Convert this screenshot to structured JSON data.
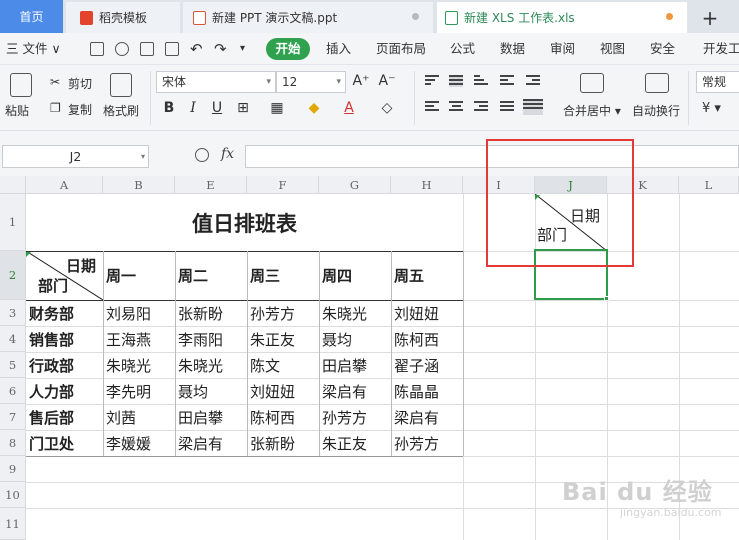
{
  "tabs": [
    {
      "label": "首页"
    },
    {
      "label": "稻壳模板"
    },
    {
      "label": "新建 PPT 演示文稿.ppt"
    },
    {
      "label": "新建 XLS 工作表.xls"
    }
  ],
  "new_tab_label": "+",
  "menu": {
    "file": "三 文件 ∨",
    "items": [
      "开始",
      "插入",
      "页面布局",
      "公式",
      "数据",
      "审阅",
      "视图",
      "安全",
      "开发工"
    ]
  },
  "ribbon": {
    "paste": "粘贴",
    "cut": "剪切",
    "copy": "复制",
    "format_painter": "格式刷",
    "font_name": "宋体",
    "font_size": "12",
    "merge_center": "合并居中",
    "wrap_text": "自动换行",
    "number_format": "常规"
  },
  "formula_bar": {
    "cell_ref": "J2",
    "fx": "fx",
    "formula": ""
  },
  "columns": [
    "A",
    "B",
    "E",
    "F",
    "G",
    "H",
    "I",
    "J",
    "K",
    "L"
  ],
  "rows": [
    "1",
    "2",
    "3",
    "4",
    "5",
    "6",
    "7",
    "8",
    "9",
    "10",
    "11"
  ],
  "sheet": {
    "title": "值日排班表",
    "header_date": "日期",
    "header_dept": "部门",
    "days": [
      "周一",
      "周二",
      "周三",
      "周四",
      "周五"
    ],
    "schedule": [
      {
        "dept": "财务部",
        "names": [
          "刘易阳",
          "张新盼",
          "孙芳方",
          "朱晓光",
          "刘妞妞"
        ]
      },
      {
        "dept": "销售部",
        "names": [
          "王海燕",
          "李雨阳",
          "朱正友",
          "聂均",
          "陈柯西"
        ]
      },
      {
        "dept": "行政部",
        "names": [
          "朱晓光",
          "朱晓光",
          "陈文",
          "田启攀",
          "翟子涵"
        ]
      },
      {
        "dept": "人力部",
        "names": [
          "李先明",
          "聂均",
          "刘妞妞",
          "梁启有",
          "陈晶晶"
        ]
      },
      {
        "dept": "售后部",
        "names": [
          "刘茜",
          "田启攀",
          "陈柯西",
          "孙芳方",
          "梁启有"
        ]
      },
      {
        "dept": "门卫处",
        "names": [
          "李媛媛",
          "梁启有",
          "张新盼",
          "朱正友",
          "孙芳方"
        ]
      }
    ]
  },
  "j1": {
    "date": "日期",
    "dept": "部门"
  },
  "watermark": "Bai du 经验",
  "watermark_sub": "jingyan.baidu.com",
  "colors": {
    "accent": "#30a14e",
    "selection": "#2e9b49",
    "highlight_box": "#e53935",
    "home_tab": "#4c8be8"
  }
}
